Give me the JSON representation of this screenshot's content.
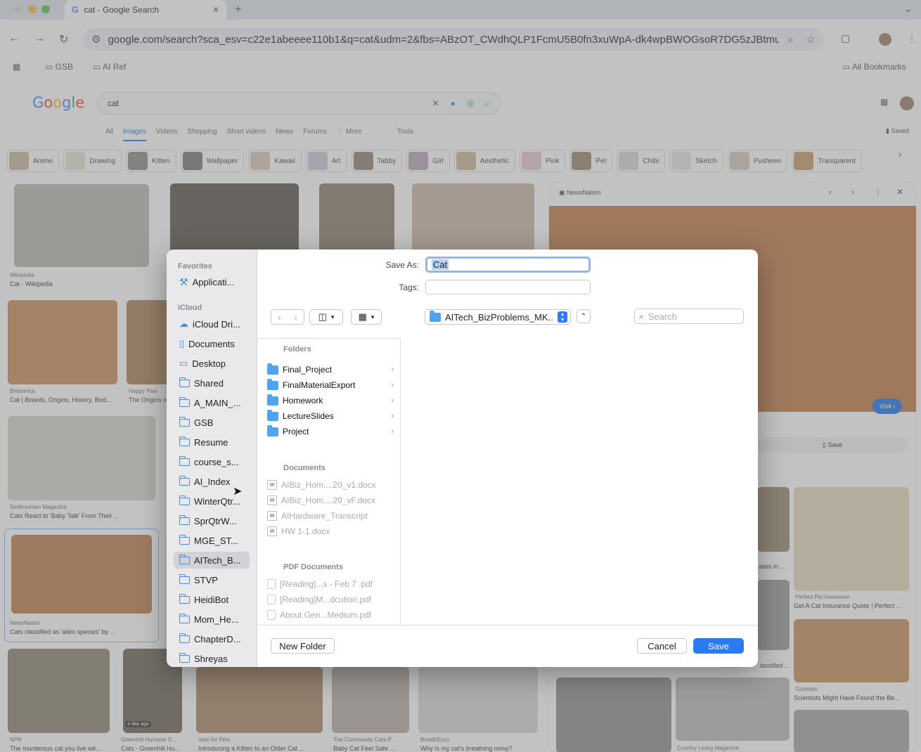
{
  "browser": {
    "tab_title": "cat - Google Search",
    "url": "google.com/search?sca_esv=c22e1abeeee110b1&q=cat&udm=2&fbs=ABzOT_CWdhQLP1FcmU5B0fn3xuWpA-dk4wpBWOGsoR7DG5zJBtmu...",
    "bookmarks": [
      "GSB",
      "AI Ref"
    ],
    "all_bookmarks": "All Bookmarks"
  },
  "google": {
    "logo": "Google",
    "query": "cat",
    "tabs": [
      "All",
      "Images",
      "Videos",
      "Shopping",
      "Short videos",
      "News",
      "Forums",
      "⋮ More",
      "Tools"
    ],
    "saved": "Saved",
    "chips": [
      "Anime",
      "Drawing",
      "Kitten",
      "Wallpaper",
      "Kawaii",
      "Art",
      "Tabby",
      "Girl",
      "Aesthetic",
      "Pink",
      "Pet",
      "Chibi",
      "Sketch",
      "Pusheen",
      "Transparent"
    ],
    "results": [
      {
        "source": "Wikipedia",
        "caption": "Cat - Wikipedia"
      },
      {
        "source": "Britannica",
        "caption": "Cat | Breeds, Origins, History, Bod..."
      },
      {
        "source": "Happy Paw",
        "caption": "The Origins o"
      },
      {
        "source": "Smithsonian Magazine",
        "caption": "Cats React to 'Baby Talk' From Their ..."
      },
      {
        "source": "NewsNation",
        "caption": "Cats classified as 'alien species' by ..."
      },
      {
        "source": "NPR",
        "caption": "The murderous cat you live wit..."
      },
      {
        "source": "Greenhill Humane S...",
        "caption": "Cats - Greenhill Hu..."
      },
      {
        "source": "Vets for Pets",
        "caption": "Introducing a Kitten to an Older Cat ..."
      },
      {
        "source": "The Community Cats P...",
        "caption": "Baby Cat Feel Safe ..."
      },
      {
        "source": "BreathEazy",
        "caption": "Why is my cat's breathing noisy?"
      },
      {
        "source": "Perfect Pet Insurance",
        "caption": "Get A Cat Insurance Quote | Perfect ..."
      },
      {
        "source": "Gizmodo",
        "caption": "Scientists Might Have Found the Be..."
      },
      {
        "source": "Country Living Magazine",
        "caption": ""
      }
    ],
    "day_badge": "a day ago",
    "side_fragments": [
      "alies in ...",
      "lassified ..."
    ],
    "preview": {
      "source": "NewsNation",
      "visit": "Visit ›",
      "save": "Save"
    }
  },
  "dialog": {
    "save_as_label": "Save As:",
    "save_as_value": "Cat",
    "tags_label": "Tags:",
    "location": "AITech_BizProblems_MK...",
    "search_placeholder": "Search",
    "sidebar": {
      "favorites_header": "Favorites",
      "favorites": [
        "Applicati..."
      ],
      "icloud_header": "iCloud",
      "icloud": [
        "iCloud Dri...",
        "Documents",
        "Desktop",
        "Shared",
        "A_MAIN_...",
        "GSB",
        "Resume",
        "course_s...",
        "AI_Index",
        "WinterQtr...",
        "SprQtrW...",
        "MGE_ST...",
        "AITech_B...",
        "STVP",
        "HeidiBot",
        "Mom_He...",
        "ChapterD...",
        "Shreyas"
      ]
    },
    "folders_header": "Folders",
    "folders": [
      "Final_Project",
      "FinalMaterialExport",
      "Homework",
      "LectureSlides",
      "Project"
    ],
    "documents_header": "Documents",
    "documents": [
      "AIBiz_Hom....20_v1.docx",
      "AIBiz_Hom....20_vF.docx",
      "AIHardware_Transcript",
      "HW 1-1.docx"
    ],
    "pdf_header": "PDF Documents",
    "pdfs": [
      "[Reading]...s - Feb 7 .pdf",
      "[Reading]M...dcution.pdf",
      "About Gen...Medium.pdf"
    ],
    "new_folder": "New Folder",
    "cancel": "Cancel",
    "save": "Save"
  }
}
